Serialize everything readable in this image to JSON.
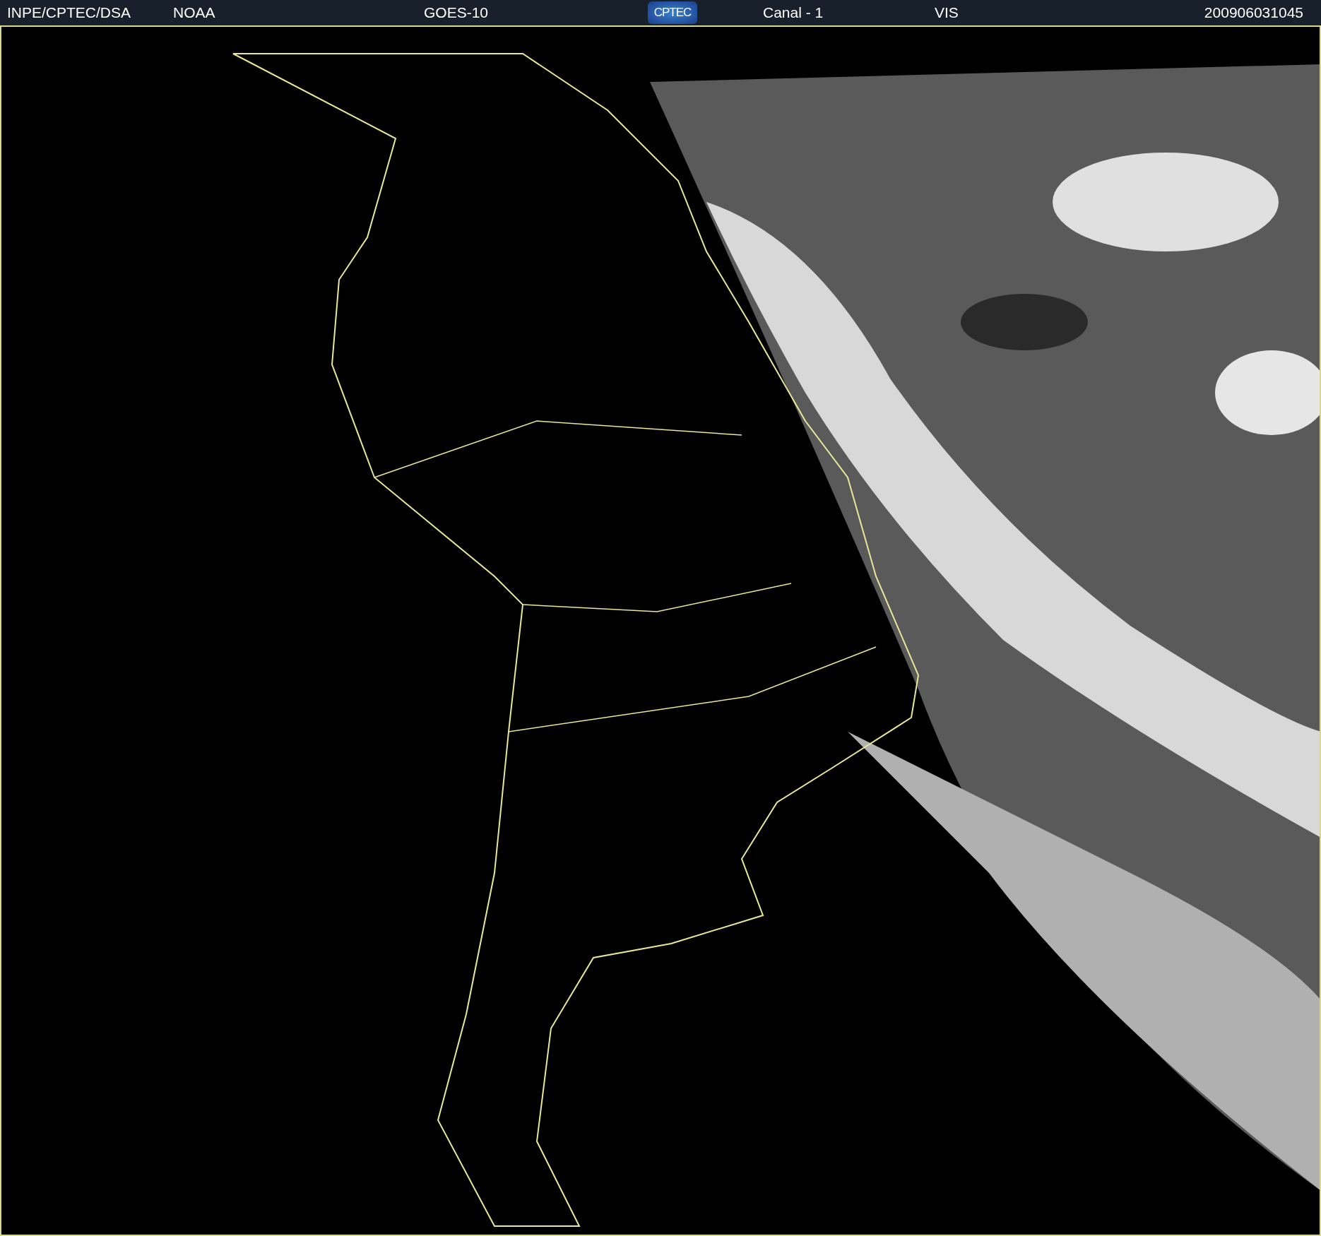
{
  "header": {
    "source": "INPE/CPTEC/DSA",
    "agency": "NOAA",
    "satellite": "GOES-10",
    "logo": "CPTEC",
    "channel": "Canal - 1",
    "band": "VIS",
    "timestamp": "200906031045"
  }
}
